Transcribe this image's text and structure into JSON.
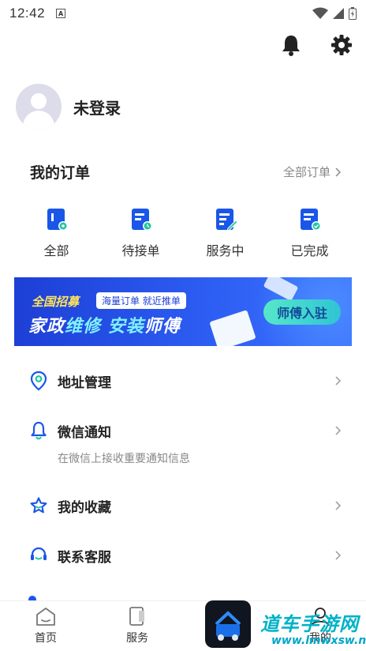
{
  "status_bar": {
    "time": "12:42",
    "a_badge": "A"
  },
  "profile": {
    "name": "未登录"
  },
  "orders": {
    "title": "我的订单",
    "all_link": "全部订单",
    "items": [
      {
        "label": "全部",
        "icon": "order-all-icon"
      },
      {
        "label": "待接单",
        "icon": "order-pending-icon"
      },
      {
        "label": "服务中",
        "icon": "order-in-service-icon"
      },
      {
        "label": "已完成",
        "icon": "order-completed-icon"
      }
    ]
  },
  "banner": {
    "tag1": "全国招募",
    "tag2": "海量订单 就近推单",
    "slogan_a": "家政",
    "slogan_b": "维修",
    "slogan_c": " 安装",
    "slogan_d": "师傅",
    "button": "师傅入驻"
  },
  "menu": {
    "address": "地址管理",
    "wechat": "微信通知",
    "wechat_sub": "在微信上接收重要通知信息",
    "favorites": "我的收藏",
    "support": "联系客服"
  },
  "bottom_nav": {
    "home": "首页",
    "service": "服务",
    "mine": "我的"
  },
  "watermark": {
    "cn": "道车手游网",
    "en": "www.lmwxsw.net"
  },
  "colors": {
    "accent": "#1a56e8",
    "green": "#1fc7a0"
  }
}
